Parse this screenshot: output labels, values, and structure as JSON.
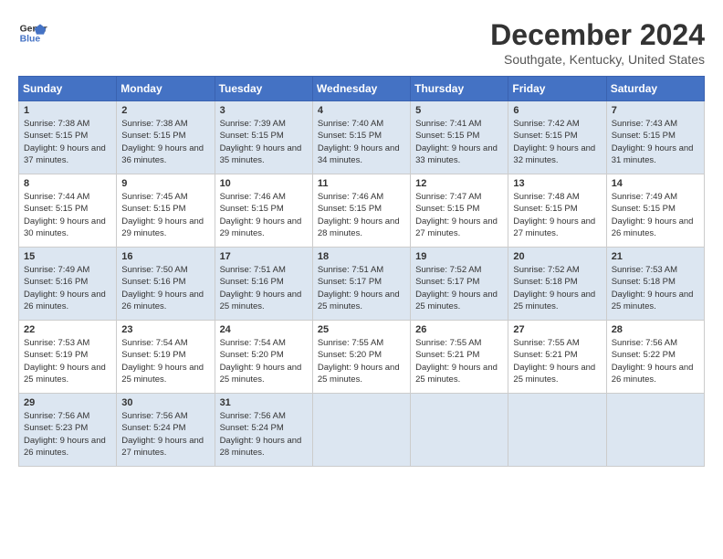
{
  "header": {
    "logo_line1": "General",
    "logo_line2": "Blue",
    "month_title": "December 2024",
    "subtitle": "Southgate, Kentucky, United States"
  },
  "days_of_week": [
    "Sunday",
    "Monday",
    "Tuesday",
    "Wednesday",
    "Thursday",
    "Friday",
    "Saturday"
  ],
  "weeks": [
    [
      {
        "day": "1",
        "sunrise": "7:38 AM",
        "sunset": "5:15 PM",
        "daylight": "9 hours and 37 minutes."
      },
      {
        "day": "2",
        "sunrise": "7:38 AM",
        "sunset": "5:15 PM",
        "daylight": "9 hours and 36 minutes."
      },
      {
        "day": "3",
        "sunrise": "7:39 AM",
        "sunset": "5:15 PM",
        "daylight": "9 hours and 35 minutes."
      },
      {
        "day": "4",
        "sunrise": "7:40 AM",
        "sunset": "5:15 PM",
        "daylight": "9 hours and 34 minutes."
      },
      {
        "day": "5",
        "sunrise": "7:41 AM",
        "sunset": "5:15 PM",
        "daylight": "9 hours and 33 minutes."
      },
      {
        "day": "6",
        "sunrise": "7:42 AM",
        "sunset": "5:15 PM",
        "daylight": "9 hours and 32 minutes."
      },
      {
        "day": "7",
        "sunrise": "7:43 AM",
        "sunset": "5:15 PM",
        "daylight": "9 hours and 31 minutes."
      }
    ],
    [
      {
        "day": "8",
        "sunrise": "7:44 AM",
        "sunset": "5:15 PM",
        "daylight": "9 hours and 30 minutes."
      },
      {
        "day": "9",
        "sunrise": "7:45 AM",
        "sunset": "5:15 PM",
        "daylight": "9 hours and 29 minutes."
      },
      {
        "day": "10",
        "sunrise": "7:46 AM",
        "sunset": "5:15 PM",
        "daylight": "9 hours and 29 minutes."
      },
      {
        "day": "11",
        "sunrise": "7:46 AM",
        "sunset": "5:15 PM",
        "daylight": "9 hours and 28 minutes."
      },
      {
        "day": "12",
        "sunrise": "7:47 AM",
        "sunset": "5:15 PM",
        "daylight": "9 hours and 27 minutes."
      },
      {
        "day": "13",
        "sunrise": "7:48 AM",
        "sunset": "5:15 PM",
        "daylight": "9 hours and 27 minutes."
      },
      {
        "day": "14",
        "sunrise": "7:49 AM",
        "sunset": "5:15 PM",
        "daylight": "9 hours and 26 minutes."
      }
    ],
    [
      {
        "day": "15",
        "sunrise": "7:49 AM",
        "sunset": "5:16 PM",
        "daylight": "9 hours and 26 minutes."
      },
      {
        "day": "16",
        "sunrise": "7:50 AM",
        "sunset": "5:16 PM",
        "daylight": "9 hours and 26 minutes."
      },
      {
        "day": "17",
        "sunrise": "7:51 AM",
        "sunset": "5:16 PM",
        "daylight": "9 hours and 25 minutes."
      },
      {
        "day": "18",
        "sunrise": "7:51 AM",
        "sunset": "5:17 PM",
        "daylight": "9 hours and 25 minutes."
      },
      {
        "day": "19",
        "sunrise": "7:52 AM",
        "sunset": "5:17 PM",
        "daylight": "9 hours and 25 minutes."
      },
      {
        "day": "20",
        "sunrise": "7:52 AM",
        "sunset": "5:18 PM",
        "daylight": "9 hours and 25 minutes."
      },
      {
        "day": "21",
        "sunrise": "7:53 AM",
        "sunset": "5:18 PM",
        "daylight": "9 hours and 25 minutes."
      }
    ],
    [
      {
        "day": "22",
        "sunrise": "7:53 AM",
        "sunset": "5:19 PM",
        "daylight": "9 hours and 25 minutes."
      },
      {
        "day": "23",
        "sunrise": "7:54 AM",
        "sunset": "5:19 PM",
        "daylight": "9 hours and 25 minutes."
      },
      {
        "day": "24",
        "sunrise": "7:54 AM",
        "sunset": "5:20 PM",
        "daylight": "9 hours and 25 minutes."
      },
      {
        "day": "25",
        "sunrise": "7:55 AM",
        "sunset": "5:20 PM",
        "daylight": "9 hours and 25 minutes."
      },
      {
        "day": "26",
        "sunrise": "7:55 AM",
        "sunset": "5:21 PM",
        "daylight": "9 hours and 25 minutes."
      },
      {
        "day": "27",
        "sunrise": "7:55 AM",
        "sunset": "5:21 PM",
        "daylight": "9 hours and 25 minutes."
      },
      {
        "day": "28",
        "sunrise": "7:56 AM",
        "sunset": "5:22 PM",
        "daylight": "9 hours and 26 minutes."
      }
    ],
    [
      {
        "day": "29",
        "sunrise": "7:56 AM",
        "sunset": "5:23 PM",
        "daylight": "9 hours and 26 minutes."
      },
      {
        "day": "30",
        "sunrise": "7:56 AM",
        "sunset": "5:24 PM",
        "daylight": "9 hours and 27 minutes."
      },
      {
        "day": "31",
        "sunrise": "7:56 AM",
        "sunset": "5:24 PM",
        "daylight": "9 hours and 28 minutes."
      },
      null,
      null,
      null,
      null
    ]
  ]
}
